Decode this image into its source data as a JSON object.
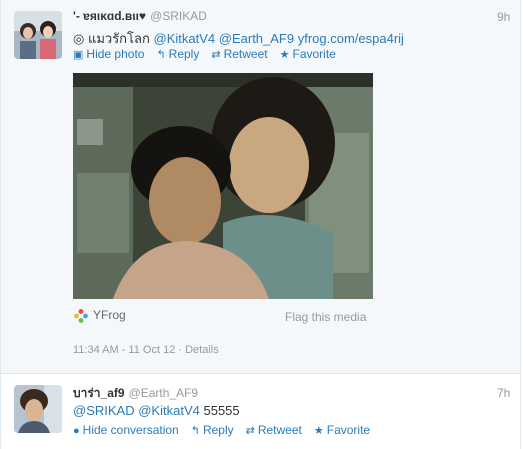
{
  "tweet1": {
    "name": "'- ɐяικɑd.ʙιι♥",
    "handle": "@SRIKAD",
    "time": "9h",
    "text_prefix": "◎ แมวรักโลก",
    "mention1": "@KitkatV4",
    "mention2": "@Earth_AF9",
    "url": "yfrog.com/espa4rij",
    "actions": {
      "hide_photo": "Hide photo",
      "reply": "Reply",
      "retweet": "Retweet",
      "favorite": "Favorite"
    },
    "media_source": "YFrog",
    "flag": "Flag this media",
    "timestamp": "11:34 AM - 11 Oct 12",
    "details": "Details",
    "separator": " · "
  },
  "tweet2": {
    "name": "บาร่า_af9",
    "handle": "@Earth_AF9",
    "time": "7h",
    "mention1": "@SRIKAD",
    "mention2": "@KitkatV4",
    "text_suffix": "55555",
    "actions": {
      "hide_conversation": "Hide conversation",
      "reply": "Reply",
      "retweet": "Retweet",
      "favorite": "Favorite"
    }
  },
  "colors": {
    "link": "#2b7bb9",
    "muted": "#999999",
    "tweet_bg": "#f5f8fa"
  },
  "icons": [
    "photo-icon",
    "reply-icon",
    "retweet-icon",
    "favorite-icon",
    "conversation-icon",
    "yfrog-icon"
  ]
}
